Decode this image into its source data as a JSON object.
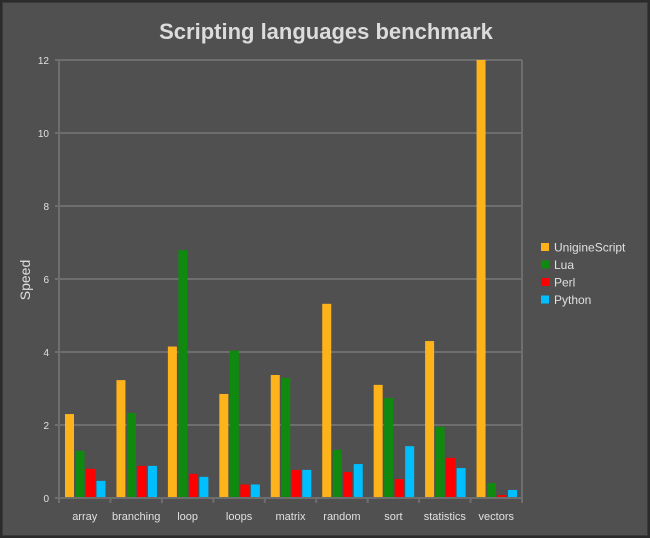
{
  "chart_data": {
    "type": "bar",
    "title": "Scripting languages benchmark",
    "xlabel": "",
    "ylabel": "Speed",
    "ylim": [
      0,
      12
    ],
    "yticks": [
      "0",
      "2",
      "4",
      "6",
      "8",
      "10",
      "12"
    ],
    "grid": true,
    "legend_position": "right",
    "categories": [
      "array",
      "branching",
      "loop",
      "loops",
      "matrix",
      "random",
      "sort",
      "statistics",
      "vectors"
    ],
    "series": [
      {
        "name": "UnigineScript",
        "color": "#ffb31a",
        "values": [
          2.3,
          3.23,
          4.15,
          2.85,
          3.37,
          5.32,
          3.1,
          4.3,
          12.0
        ]
      },
      {
        "name": "Lua",
        "color": "#0f8a0f",
        "values": [
          1.29,
          2.33,
          6.79,
          4.04,
          3.29,
          1.32,
          2.74,
          1.95,
          0.41
        ]
      },
      {
        "name": "Perl",
        "color": "#ff0000",
        "values": [
          0.8,
          0.88,
          0.66,
          0.37,
          0.77,
          0.71,
          0.52,
          1.1,
          0.08
        ]
      },
      {
        "name": "Python",
        "color": "#00bfff",
        "values": [
          0.47,
          0.88,
          0.58,
          0.37,
          0.77,
          0.93,
          1.42,
          0.82,
          0.22
        ]
      }
    ]
  }
}
